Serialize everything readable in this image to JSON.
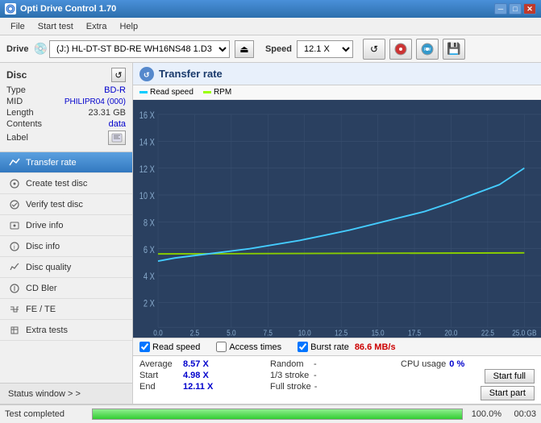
{
  "titlebar": {
    "title": "Opti Drive Control 1.70",
    "icon_label": "O"
  },
  "menubar": {
    "items": [
      "File",
      "Start test",
      "Extra",
      "Help"
    ]
  },
  "drivebar": {
    "drive_label": "Drive",
    "drive_value": "(J:)  HL-DT-ST BD-RE  WH16NS48 1.D3",
    "speed_label": "Speed",
    "speed_value": "12.1 X"
  },
  "disc": {
    "title": "Disc",
    "type_label": "Type",
    "type_value": "BD-R",
    "mid_label": "MID",
    "mid_value": "PHILIPR04 (000)",
    "length_label": "Length",
    "length_value": "23.31 GB",
    "contents_label": "Contents",
    "contents_value": "data",
    "label_label": "Label"
  },
  "nav": {
    "items": [
      {
        "id": "transfer-rate",
        "label": "Transfer rate",
        "active": true
      },
      {
        "id": "create-test-disc",
        "label": "Create test disc",
        "active": false
      },
      {
        "id": "verify-test-disc",
        "label": "Verify test disc",
        "active": false
      },
      {
        "id": "drive-info",
        "label": "Drive info",
        "active": false
      },
      {
        "id": "disc-info",
        "label": "Disc info",
        "active": false
      },
      {
        "id": "disc-quality",
        "label": "Disc quality",
        "active": false
      },
      {
        "id": "cd-bler",
        "label": "CD Bler",
        "active": false
      },
      {
        "id": "fe-te",
        "label": "FE / TE",
        "active": false
      },
      {
        "id": "extra-tests",
        "label": "Extra tests",
        "active": false
      }
    ],
    "status_window_label": "Status window > >"
  },
  "chart": {
    "title": "Transfer rate",
    "icon_label": "↺",
    "legend": {
      "read_speed_label": "Read speed",
      "rpm_label": "RPM"
    },
    "y_axis": [
      "16 X",
      "14 X",
      "12 X",
      "10 X",
      "8 X",
      "6 X",
      "4 X",
      "2 X"
    ],
    "x_axis": [
      "0.0",
      "2.5",
      "5.0",
      "7.5",
      "10.0",
      "12.5",
      "15.0",
      "17.5",
      "20.0",
      "22.5",
      "25.0 GB"
    ]
  },
  "checkboxes": {
    "read_speed_label": "Read speed",
    "read_speed_checked": true,
    "access_times_label": "Access times",
    "access_times_checked": false,
    "burst_rate_label": "Burst rate",
    "burst_rate_checked": true,
    "burst_rate_value": "86.6 MB/s"
  },
  "stats": {
    "average_label": "Average",
    "average_value": "8.57 X",
    "random_label": "Random",
    "random_value": "-",
    "cpu_usage_label": "CPU usage",
    "cpu_usage_value": "0 %",
    "start_label": "Start",
    "start_value": "4.98 X",
    "stroke_1_3_label": "1/3 stroke",
    "stroke_1_3_value": "-",
    "start_full_label": "Start full",
    "end_label": "End",
    "end_value": "12.11 X",
    "full_stroke_label": "Full stroke",
    "full_stroke_value": "-",
    "start_part_label": "Start part"
  },
  "statusbar": {
    "test_completed_label": "Test completed",
    "progress_percent": "100.0%",
    "progress_value": 100,
    "time_label": "00:03"
  }
}
